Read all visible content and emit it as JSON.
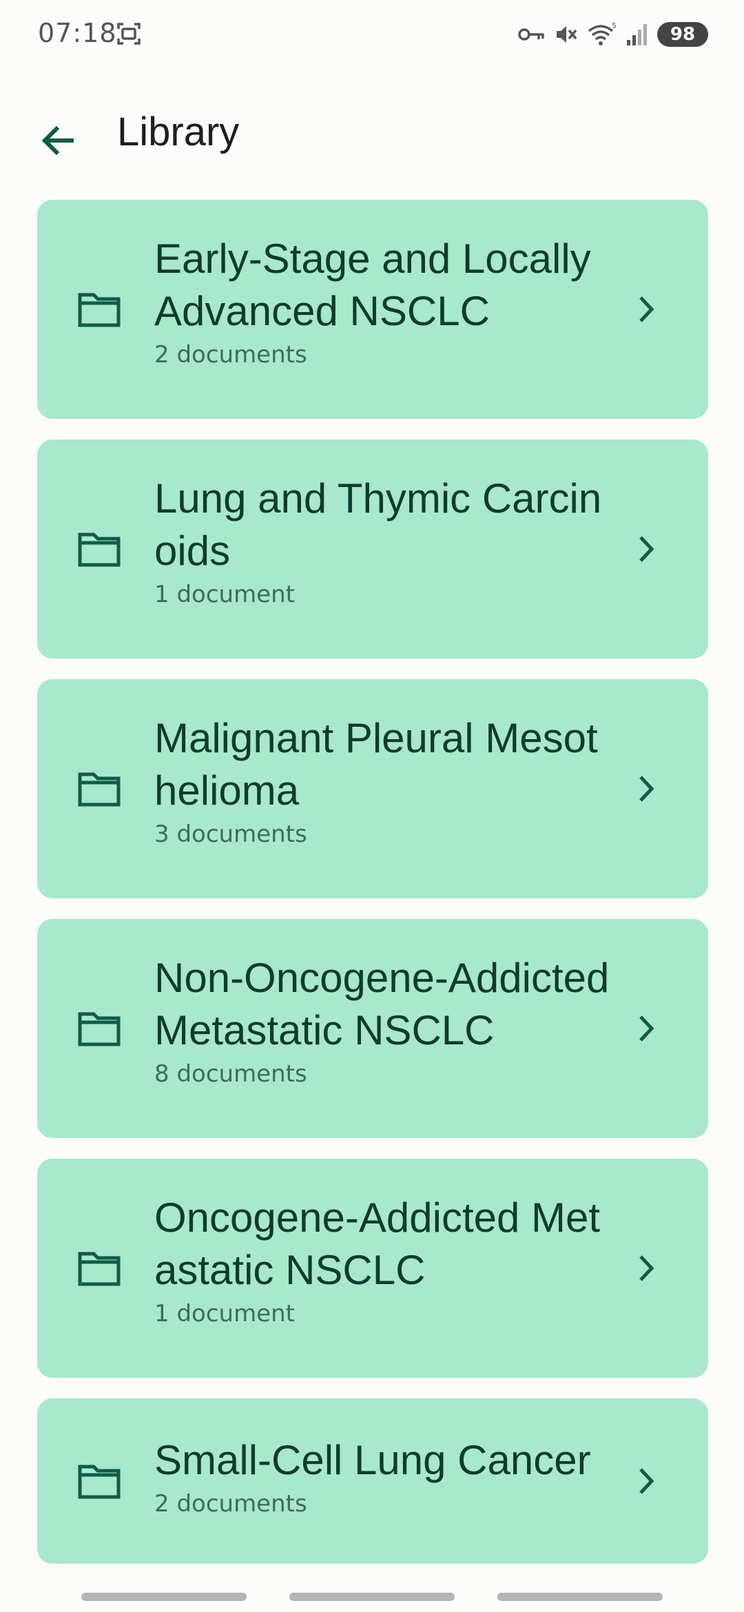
{
  "status_bar": {
    "time": "07:18",
    "battery": "98",
    "icons": [
      "screenshot-icon",
      "vpn-key-icon",
      "mute-icon",
      "wifi-icon",
      "signal-icon"
    ]
  },
  "app_bar": {
    "title": "Library",
    "back_icon": "arrow-left-icon"
  },
  "colors": {
    "card_background": "#a8e8cc",
    "accent": "#0f5c48",
    "title_text": "#0f3b2d",
    "subtitle_text": "#3e6b5b"
  },
  "folders": [
    {
      "title": "Early-Stage and Locally Advanced NSCLC",
      "count": "2 documents",
      "icon": "folder-icon"
    },
    {
      "title": "Lung and Thymic Carcinoids",
      "count": "1 document",
      "icon": "folder-icon"
    },
    {
      "title": "Malignant Pleural Mesothelioma",
      "count": "3 documents",
      "icon": "folder-icon"
    },
    {
      "title": "Non-Oncogene-Addicted Metastatic NSCLC",
      "count": "8 documents",
      "icon": "folder-icon"
    },
    {
      "title": "Oncogene-Addicted Metastatic NSCLC",
      "count": "1 document",
      "icon": "folder-icon"
    },
    {
      "title": "Small-Cell Lung Cancer",
      "count": "2 documents",
      "icon": "folder-icon"
    }
  ]
}
